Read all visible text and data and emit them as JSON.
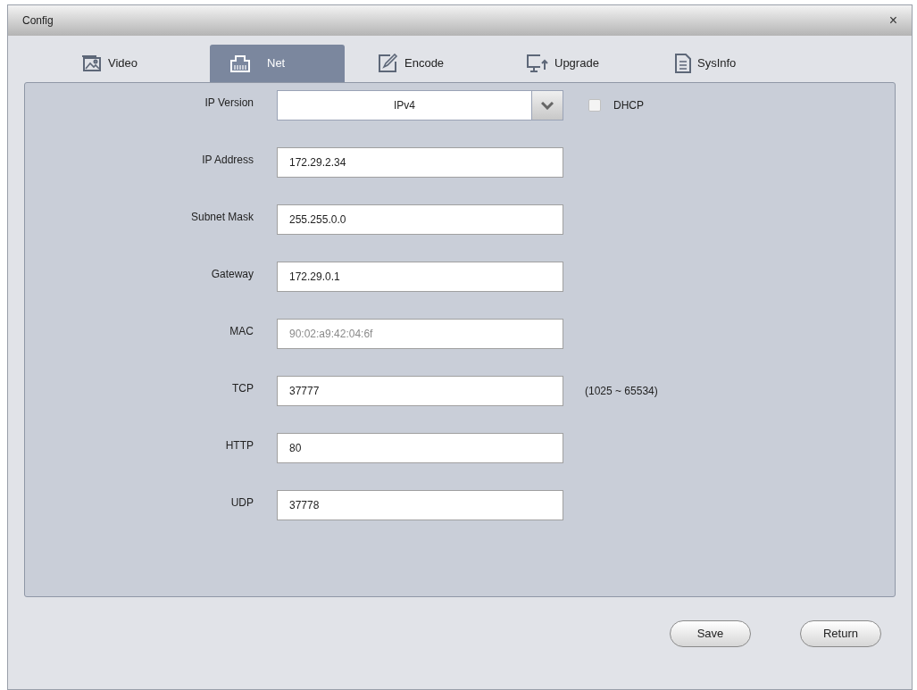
{
  "window": {
    "title": "Config",
    "close": "×"
  },
  "tabs": [
    {
      "label": "Video",
      "selected": false
    },
    {
      "label": "Net",
      "selected": true
    },
    {
      "label": "Encode",
      "selected": false
    },
    {
      "label": "Upgrade",
      "selected": false
    },
    {
      "label": "SysInfo",
      "selected": false
    }
  ],
  "fields": [
    {
      "kind": "select",
      "label": "IP Version",
      "value": "IPv4",
      "checkbox": {
        "label": "DHCP",
        "checked": false
      }
    },
    {
      "kind": "text",
      "label": "IP Address",
      "value": "172.29.2.34",
      "disabled": false
    },
    {
      "kind": "text",
      "label": "Subnet Mask",
      "value": "255.255.0.0",
      "disabled": false
    },
    {
      "kind": "text",
      "label": "Gateway",
      "value": "172.29.0.1",
      "disabled": false
    },
    {
      "kind": "text",
      "label": "MAC",
      "value": "90:02:a9:42:04:6f",
      "disabled": true
    },
    {
      "kind": "text",
      "label": "TCP",
      "value": "37777",
      "disabled": false,
      "hint": "(1025 ~ 65534)"
    },
    {
      "kind": "text",
      "label": "HTTP",
      "value": "80",
      "disabled": false
    },
    {
      "kind": "text",
      "label": "UDP",
      "value": "37778",
      "disabled": false
    }
  ],
  "buttons": [
    "Save",
    "Return"
  ]
}
